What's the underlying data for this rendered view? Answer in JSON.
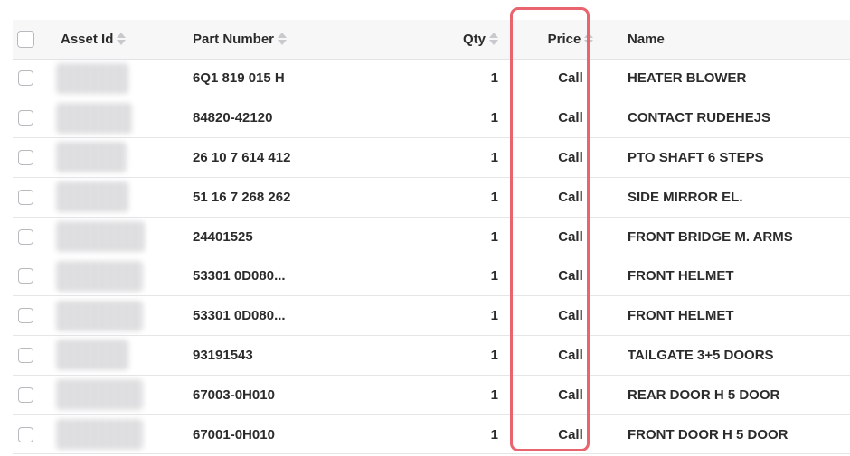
{
  "columns": {
    "asset_id": "Asset Id",
    "part_number": "Part Number",
    "qty": "Qty",
    "price": "Price",
    "name": "Name"
  },
  "icons": {
    "sort": "sort-icon",
    "checkbox": "checkbox-icon"
  },
  "colors": {
    "highlight": "#e8656f",
    "header_bg": "#f7f7f8",
    "border": "#e4e4e6"
  },
  "rows": [
    {
      "asset_width": 80,
      "part_number": "6Q1 819 015 H",
      "qty": "1",
      "price": "Call",
      "name": "HEATER BLOWER"
    },
    {
      "asset_width": 84,
      "part_number": "84820-42120",
      "qty": "1",
      "price": "Call",
      "name": "CONTACT RUDEHEJS"
    },
    {
      "asset_width": 78,
      "part_number": "26 10 7 614 412",
      "qty": "1",
      "price": "Call",
      "name": "PTO SHAFT 6 STEPS"
    },
    {
      "asset_width": 80,
      "part_number": "51 16 7 268 262",
      "qty": "1",
      "price": "Call",
      "name": "SIDE MIRROR EL."
    },
    {
      "asset_width": 98,
      "part_number": "24401525",
      "qty": "1",
      "price": "Call",
      "name": "FRONT BRIDGE M. ARMS"
    },
    {
      "asset_width": 96,
      "part_number": "53301 0D080...",
      "qty": "1",
      "price": "Call",
      "name": "FRONT HELMET"
    },
    {
      "asset_width": 96,
      "part_number": "53301 0D080...",
      "qty": "1",
      "price": "Call",
      "name": "FRONT HELMET"
    },
    {
      "asset_width": 80,
      "part_number": "93191543",
      "qty": "1",
      "price": "Call",
      "name": "TAILGATE 3+5 DOORS"
    },
    {
      "asset_width": 96,
      "part_number": "67003-0H010",
      "qty": "1",
      "price": "Call",
      "name": "REAR DOOR H 5 DOOR"
    },
    {
      "asset_width": 96,
      "part_number": "67001-0H010",
      "qty": "1",
      "price": "Call",
      "name": "FRONT DOOR H 5 DOOR"
    }
  ]
}
